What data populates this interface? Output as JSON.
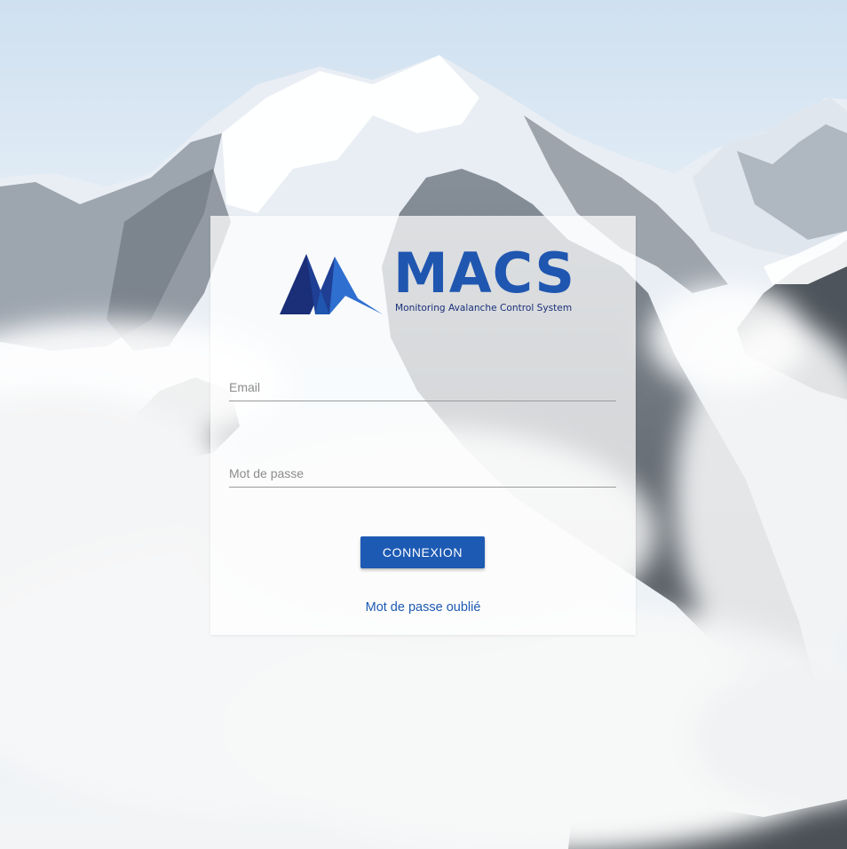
{
  "brand": {
    "title": "MACS",
    "subtitle": "Monitoring Avalanche Control System",
    "logo_icon": "mountain-icon",
    "color_primary": "#1f56b0",
    "color_dark": "#1b2f78"
  },
  "form": {
    "email_placeholder": "Email",
    "email_value": "",
    "password_placeholder": "Mot de passe",
    "password_value": "",
    "submit_label": "CONNEXION",
    "forgot_label": "Mot de passe oublié"
  },
  "background": {
    "description_icon": "mountain-landscape-image"
  }
}
